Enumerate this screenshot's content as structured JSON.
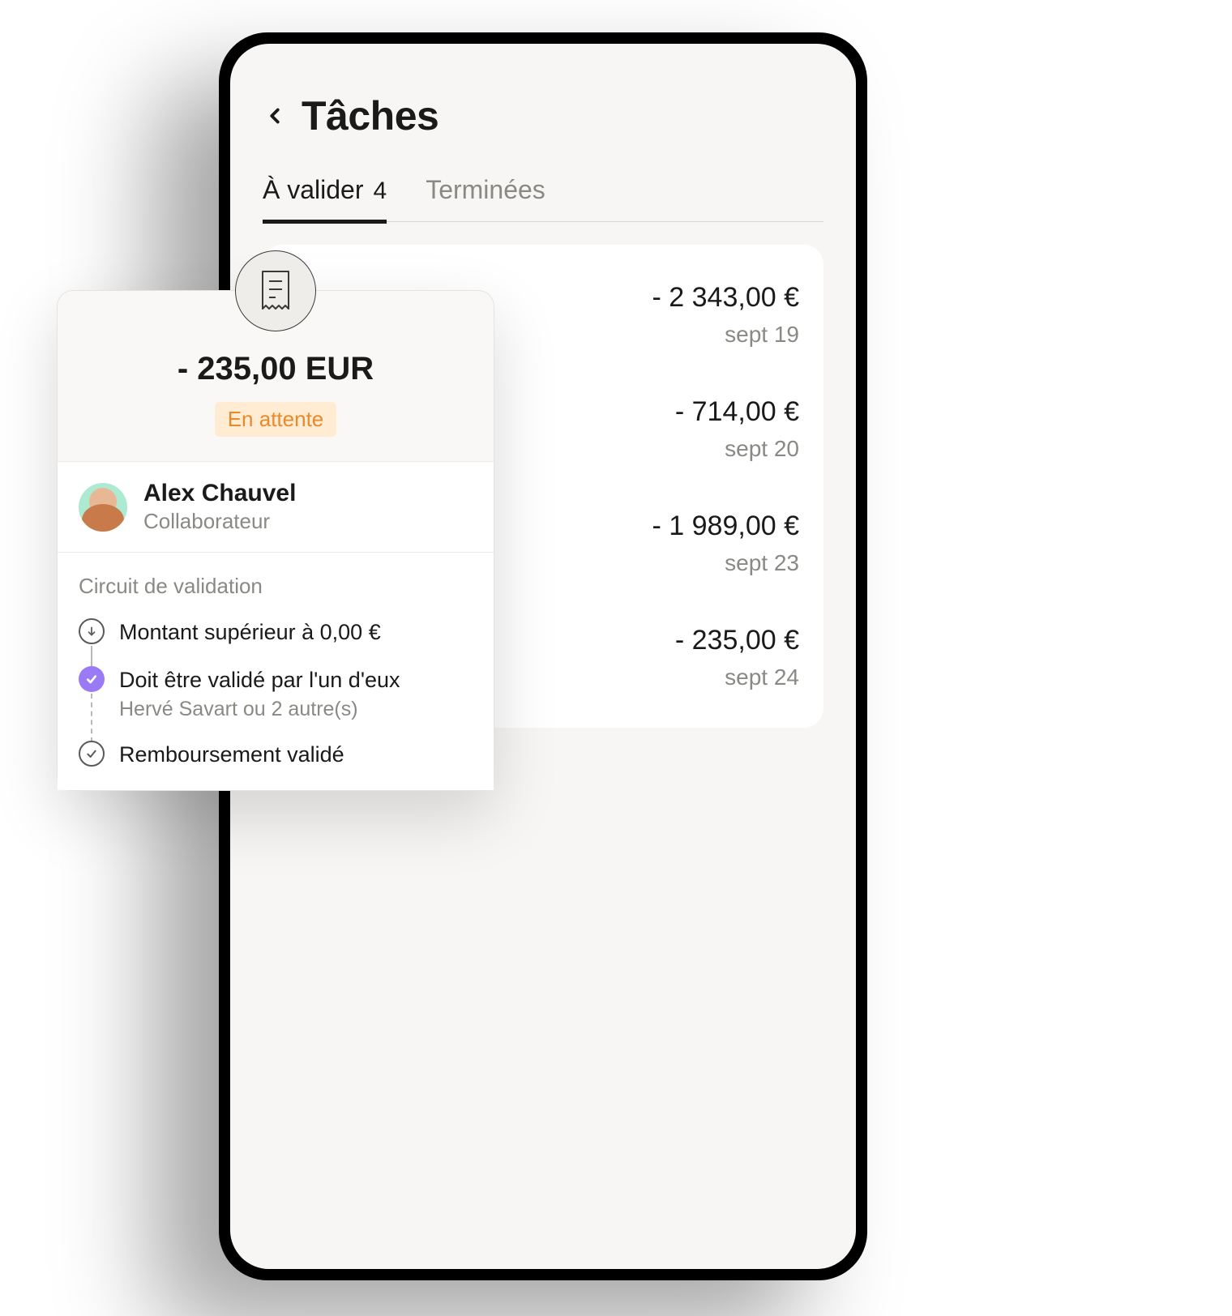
{
  "header": {
    "title": "Tâches"
  },
  "tabs": {
    "validate": {
      "label": "À valider",
      "count": "4"
    },
    "done": {
      "label": "Terminées"
    }
  },
  "tasks": [
    {
      "amount": "- 2 343,00 €",
      "date": "sept 19"
    },
    {
      "amount": "- 714,00 €",
      "date": "sept 20"
    },
    {
      "amount": "- 1 989,00 €",
      "date": "sept 23"
    },
    {
      "amount": "- 235,00 €",
      "date": "sept 24"
    }
  ],
  "detail": {
    "amount": "- 235,00 EUR",
    "status": "En attente",
    "person": {
      "name": "Alex Chauvel",
      "role": "Collaborateur"
    },
    "validation": {
      "title": "Circuit de validation",
      "steps": [
        {
          "title": "Montant supérieur à 0,00 €"
        },
        {
          "title": "Doit être validé par l'un d'eux",
          "subtitle": "Hervé Savart ou 2 autre(s)"
        },
        {
          "title": "Remboursement validé"
        }
      ]
    }
  }
}
